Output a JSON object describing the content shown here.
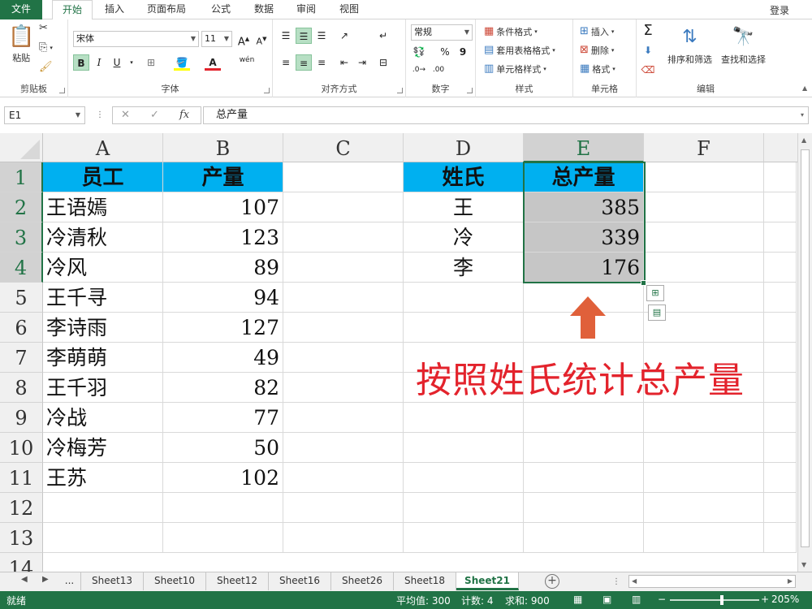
{
  "tabs": {
    "file": "文件",
    "items": [
      "开始",
      "插入",
      "页面布局",
      "公式",
      "数据",
      "审阅",
      "视图"
    ],
    "active": "开始",
    "login": "登录"
  },
  "ribbon": {
    "clipboard": {
      "paste": "粘贴",
      "label": "剪贴板"
    },
    "font": {
      "name": "宋体",
      "size": "11",
      "bold": "B",
      "italic": "I",
      "underline": "U",
      "grow": "A",
      "shrink": "A",
      "phonetic": "wén",
      "label": "字体"
    },
    "alignment": {
      "label": "对齐方式"
    },
    "number": {
      "format": "常规",
      "percent": "%",
      "comma": "9",
      "label": "数字"
    },
    "styles": {
      "conditional": "条件格式",
      "table": "套用表格格式",
      "cell": "单元格样式",
      "label": "样式"
    },
    "cells": {
      "insert": "插入",
      "delete": "删除",
      "format": "格式",
      "label": "单元格"
    },
    "editing": {
      "sort": "排序和筛选",
      "find": "查找和选择",
      "label": "编辑"
    }
  },
  "formula_bar": {
    "name_box": "E1",
    "cancel": "✕",
    "enter": "✓",
    "fx": "fx",
    "content": "总产量"
  },
  "sheet": {
    "columns": [
      "A",
      "B",
      "C",
      "D",
      "E",
      "F"
    ],
    "selected_column": "E",
    "rows": [
      "1",
      "2",
      "3",
      "4",
      "5",
      "6",
      "7",
      "8",
      "9",
      "10",
      "11",
      "12",
      "13",
      "14"
    ],
    "selected_rows": [
      "1",
      "2",
      "3",
      "4"
    ],
    "A": [
      "员工",
      "王语嫣",
      "冷清秋",
      "冷风",
      "王千寻",
      "李诗雨",
      "李萌萌",
      "王千羽",
      "冷战",
      "冷梅芳",
      "王苏"
    ],
    "B": [
      "产量",
      "107",
      "123",
      "89",
      "94",
      "127",
      "49",
      "82",
      "77",
      "50",
      "102"
    ],
    "D": [
      "姓氏",
      "王",
      "冷",
      "李"
    ],
    "E": [
      "总产量",
      "385",
      "339",
      "176"
    ],
    "header_fill": "#00b0f0",
    "selection_fill": "#c6c6c6"
  },
  "annotation": {
    "text": "按照姓氏统计总产量",
    "color": "#e3232c"
  },
  "sheet_tabs": {
    "ellipsis": "...",
    "items": [
      "Sheet13",
      "Sheet10",
      "Sheet12",
      "Sheet16",
      "Sheet26",
      "Sheet18",
      "Sheet21"
    ],
    "active": "Sheet21"
  },
  "status_bar": {
    "mode": "就绪",
    "average": "平均值: 300",
    "count": "计数: 4",
    "sum": "求和: 900",
    "zoom": "205%"
  },
  "colors": {
    "accent": "#217346"
  }
}
